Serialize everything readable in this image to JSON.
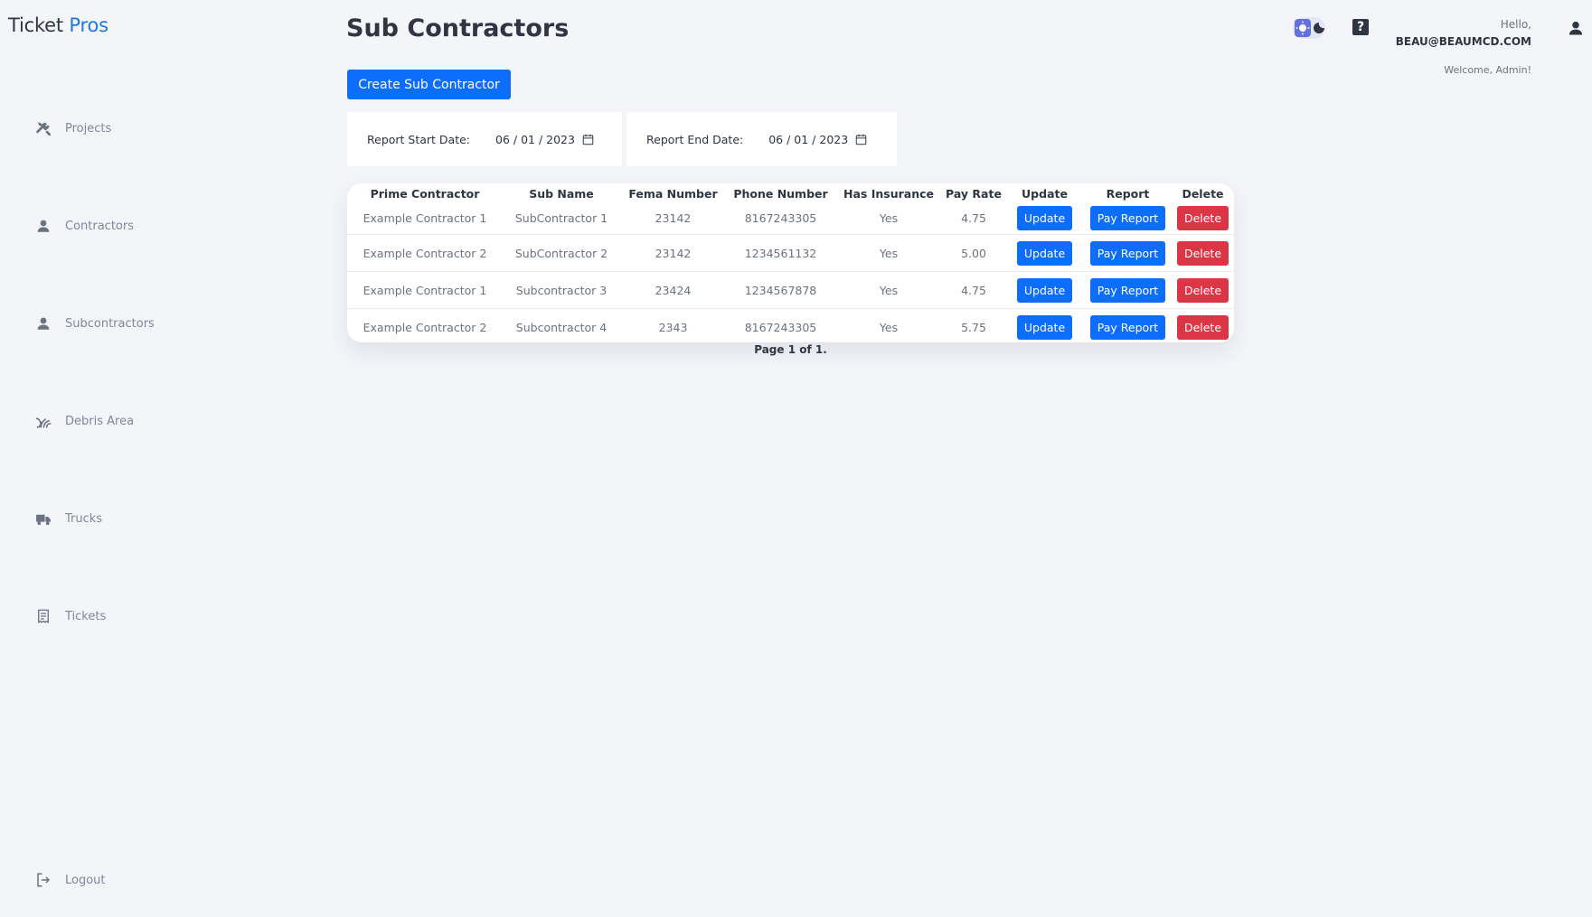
{
  "brand": {
    "name": "Ticket",
    "accent": "Pros"
  },
  "sidebar": {
    "items": [
      {
        "label": "Projects",
        "icon": "tools-icon"
      },
      {
        "label": "Contractors",
        "icon": "person-icon"
      },
      {
        "label": "Subcontractors",
        "icon": "person-icon"
      },
      {
        "label": "Debris Area",
        "icon": "grass-icon"
      },
      {
        "label": "Trucks",
        "icon": "truck-icon"
      },
      {
        "label": "Tickets",
        "icon": "receipt-icon"
      },
      {
        "label": "Logout",
        "icon": "logout-icon"
      }
    ]
  },
  "header": {
    "title": "Sub Contractors",
    "hello": "Hello,",
    "email": "BEAU@BEAUMCD.COM",
    "welcome": "Welcome, Admin!"
  },
  "actions": {
    "create_label": "Create Sub Contractor"
  },
  "report": {
    "start_label": "Report Start Date:",
    "start_value": "06 / 01 / 2023",
    "end_label": "Report End Date:",
    "end_value": "06 / 01 / 2023"
  },
  "table": {
    "headers": [
      "Prime Contractor",
      "Sub Name",
      "Fema Number",
      "Phone Number",
      "Has Insurance",
      "Pay Rate",
      "Update",
      "Report",
      "Delete"
    ],
    "rows": [
      {
        "prime": "Example Contractor 1",
        "sub": "SubContractor 1",
        "fema": "23142",
        "phone": "8167243305",
        "insurance": "Yes",
        "rate": "4.75"
      },
      {
        "prime": "Example Contractor 2",
        "sub": "SubContractor 2",
        "fema": "23142",
        "phone": "1234561132",
        "insurance": "Yes",
        "rate": "5.00"
      },
      {
        "prime": "Example Contractor 1",
        "sub": "Subcontractor 3",
        "fema": "23424",
        "phone": "1234567878",
        "insurance": "Yes",
        "rate": "4.75"
      },
      {
        "prime": "Example Contractor 2",
        "sub": "Subcontractor 4",
        "fema": "2343",
        "phone": "8167243305",
        "insurance": "Yes",
        "rate": "5.75"
      }
    ],
    "update_label": "Update",
    "report_label": "Pay Report",
    "delete_label": "Delete"
  },
  "pagination": {
    "text": "Page 1 of 1."
  },
  "colors": {
    "accent": "#0d6efd",
    "danger": "#dc3545",
    "brand_accent": "#1f77e0",
    "background": "#f4f5f9"
  }
}
